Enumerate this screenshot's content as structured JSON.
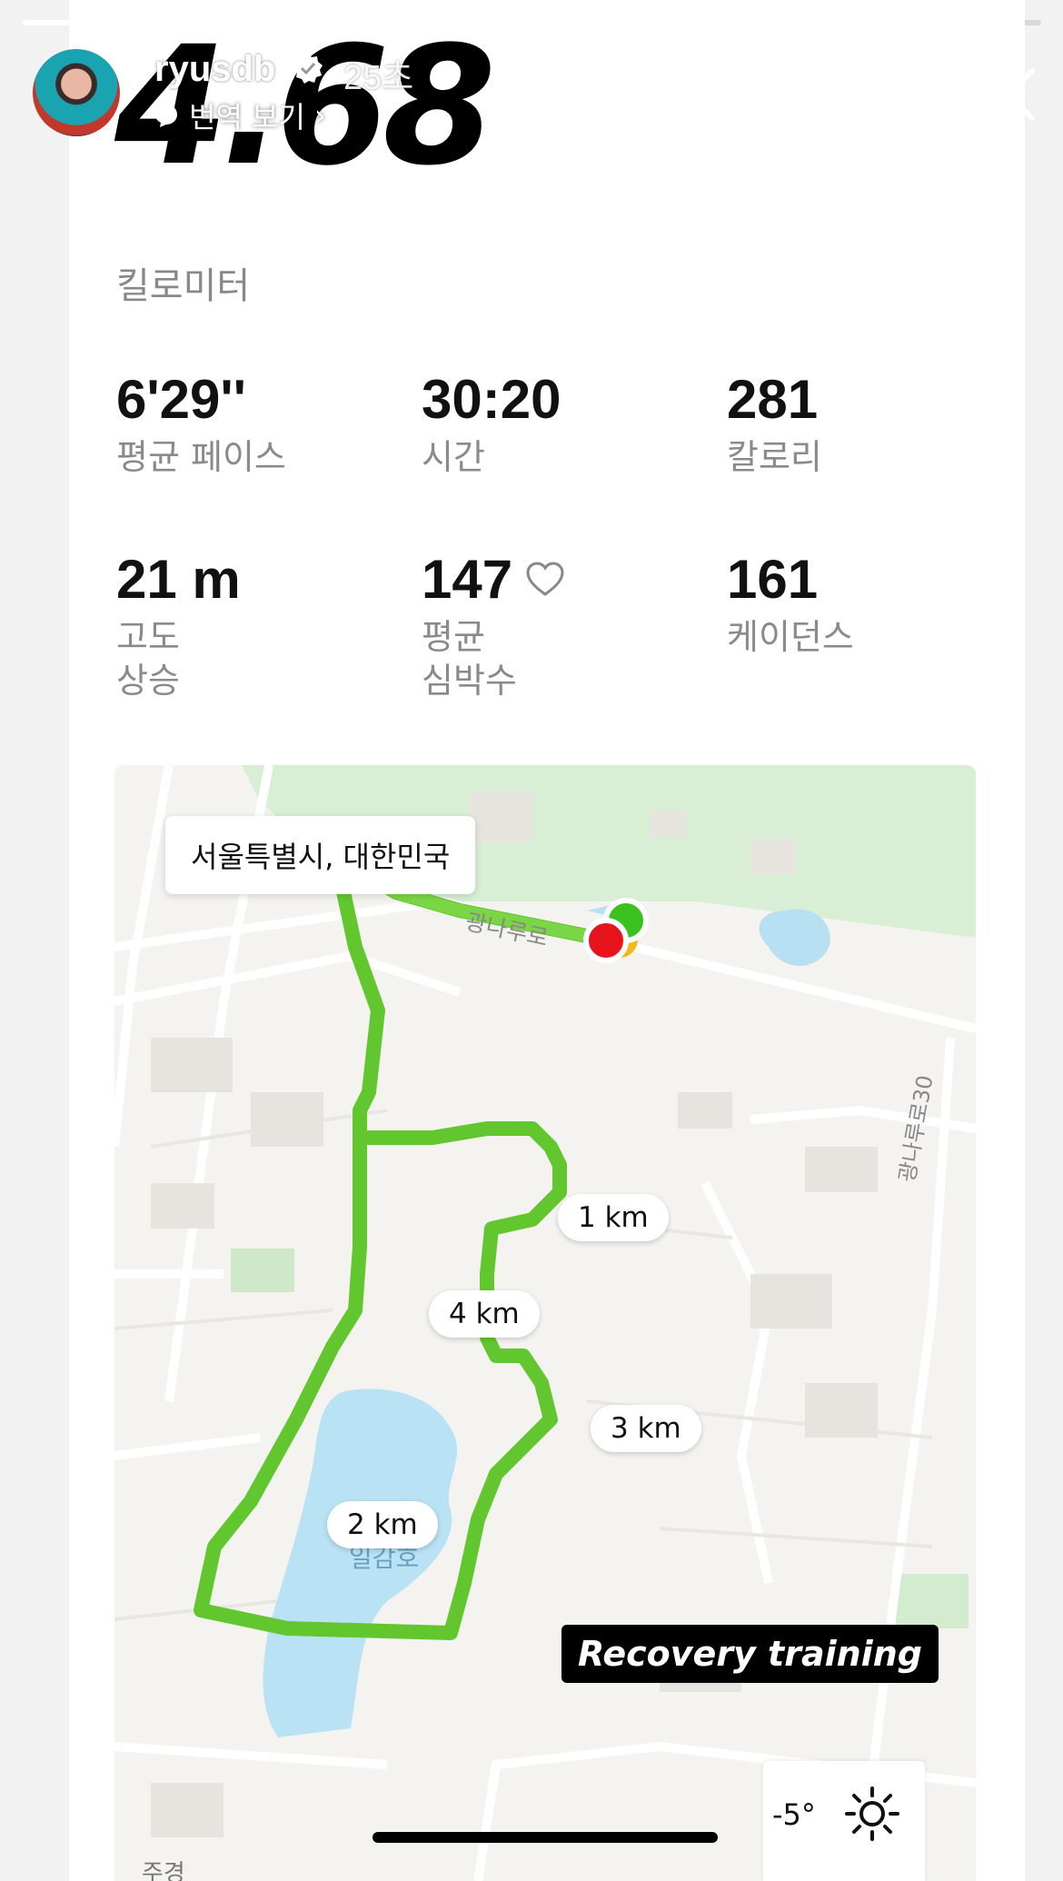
{
  "story": {
    "progress": 0.55,
    "username": "ryusdb",
    "time_ago": "25초",
    "translate_label": "번역 보기"
  },
  "run": {
    "distance": "4.68",
    "distance_unit": "킬로미터",
    "stats": [
      {
        "value": "6'29''",
        "label": "평균 페이스"
      },
      {
        "value": "30:20",
        "label": "시간"
      },
      {
        "value": "281",
        "label": "칼로리"
      },
      {
        "value": "21 m",
        "label": "고도\n상승"
      },
      {
        "value": "147",
        "label": "평균\n심박수"
      },
      {
        "value": "161",
        "label": "케이던스"
      }
    ]
  },
  "map": {
    "location": "서울특별시, 대한민국",
    "road_label": "광나루로",
    "road_label_2": "광나루로30",
    "lake_label": "일감호",
    "bottom_cut_label": "주경",
    "km_markers": [
      "1 km",
      "2 km",
      "3 km",
      "4 km"
    ],
    "route_color": "#6ad13a",
    "start_color": "#3cc21f",
    "end_color": "#e8141c"
  },
  "tag": "Recovery training",
  "weather": {
    "temp": "-5°",
    "icon": "sun-icon"
  }
}
